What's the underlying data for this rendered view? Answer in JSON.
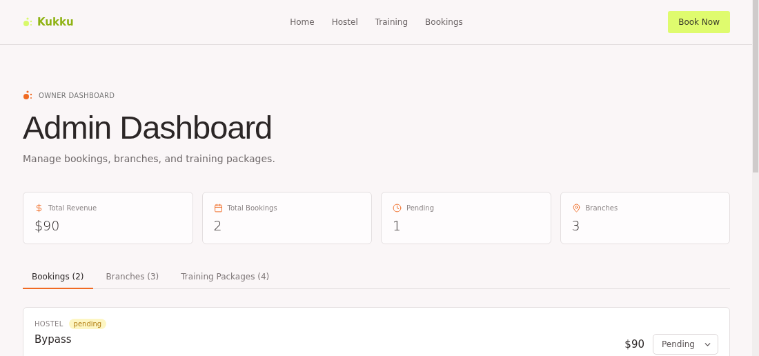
{
  "header": {
    "logo": "Kukku",
    "nav": [
      {
        "label": "Home"
      },
      {
        "label": "Hostel"
      },
      {
        "label": "Training"
      },
      {
        "label": "Bookings"
      }
    ],
    "cta": "Book Now"
  },
  "hero": {
    "eyebrow": "OWNER DASHBOARD",
    "title": "Admin Dashboard",
    "subtitle": "Manage bookings, branches, and training packages."
  },
  "stats": [
    {
      "label": "Total Revenue",
      "value": "$90"
    },
    {
      "label": "Total Bookings",
      "value": "2"
    },
    {
      "label": "Pending",
      "value": "1"
    },
    {
      "label": "Branches",
      "value": "3"
    }
  ],
  "tabs": [
    {
      "label": "Bookings (2)",
      "selected": true
    },
    {
      "label": "Branches (3)",
      "selected": false
    },
    {
      "label": "Training Packages (4)",
      "selected": false
    }
  ],
  "bookings": [
    {
      "category": "HOSTEL",
      "status": "pending",
      "name": "Bypass",
      "price": "$90",
      "status_select": "Pending"
    }
  ]
}
